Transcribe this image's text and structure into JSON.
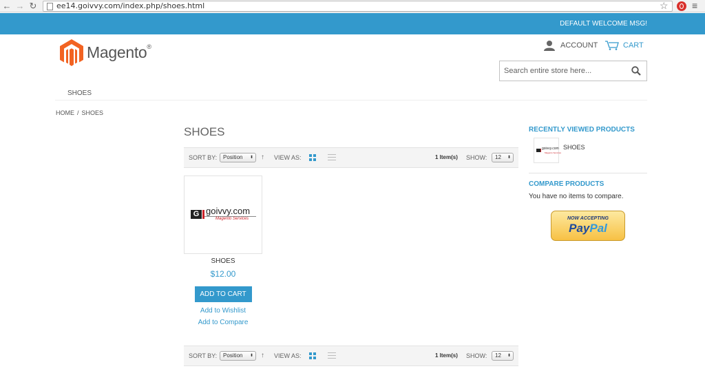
{
  "browser": {
    "url": "ee14.goivvy.com/index.php/shoes.html"
  },
  "header": {
    "welcome": "DEFAULT WELCOME MSG!",
    "logo_text": "Magento",
    "account_label": "ACCOUNT",
    "cart_label": "CART",
    "search_placeholder": "Search entire store here..."
  },
  "nav": {
    "items": [
      {
        "label": "SHOES"
      }
    ]
  },
  "breadcrumb": {
    "home": "HOME",
    "separator": "/",
    "current": "SHOES"
  },
  "main": {
    "title": "SHOES",
    "toolbar": {
      "sort_label": "SORT BY:",
      "sort_value": "Position",
      "view_label": "VIEW AS:",
      "count": "1 Item(s)",
      "show_label": "SHOW:",
      "show_value": "12"
    },
    "products": [
      {
        "name": "SHOES",
        "price": "$12.00",
        "add_to_cart": "ADD TO CART",
        "wishlist": "Add to Wishlist",
        "compare": "Add to Compare",
        "image_brand": "goivvy.com",
        "image_tagline": "Magento Services"
      }
    ]
  },
  "sidebar": {
    "recently_viewed_title": "RECENTLY VIEWED PRODUCTS",
    "recently_viewed": [
      {
        "name": "SHOES"
      }
    ],
    "compare_title": "COMPARE PRODUCTS",
    "compare_empty": "You have no items to compare.",
    "paypal_top": "NOW ACCEPTING",
    "paypal_logo_a": "Pay",
    "paypal_logo_b": "Pal"
  },
  "colors": {
    "accent": "#3399cc",
    "brand_orange": "#f26322"
  }
}
